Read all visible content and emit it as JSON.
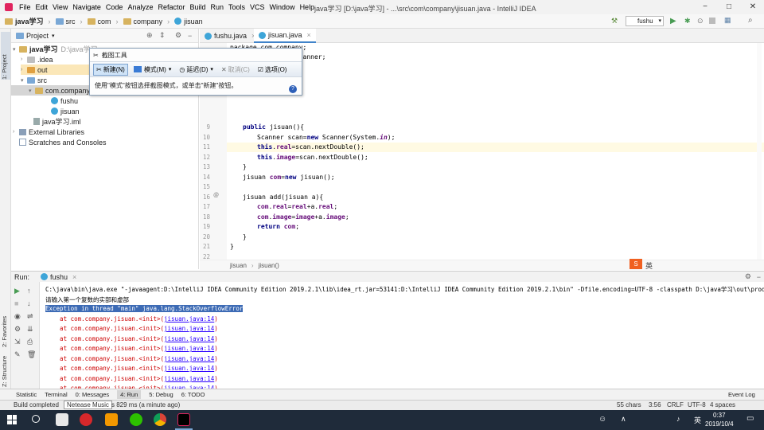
{
  "menubar": {
    "items": [
      "File",
      "Edit",
      "View",
      "Navigate",
      "Code",
      "Analyze",
      "Refactor",
      "Build",
      "Run",
      "Tools",
      "VCS",
      "Window",
      "Help"
    ],
    "title": "java学习 [D:\\java学习] - ...\\src\\com\\company\\jisuan.java - IntelliJ IDEA"
  },
  "navbar": {
    "crumbs": [
      "java学习",
      "src",
      "com",
      "company",
      "jisuan"
    ],
    "run_config": "fushu"
  },
  "leftstrip": {
    "project_tab": "1: Project",
    "favorites_tab": "2: Favorites",
    "structure_tab": "Z: Structure"
  },
  "project": {
    "header": "Project",
    "root_name": "java学习",
    "root_path": "D:\\java学习",
    "items": [
      ".idea",
      "out",
      "src",
      "com.company",
      "fushu",
      "jisuan",
      "java学习.iml",
      "External Libraries",
      "Scratches and Consoles"
    ]
  },
  "editor": {
    "tabs": [
      "fushu.java",
      "jisuan.java"
    ],
    "line_numbers": [
      "",
      "",
      "",
      "",
      "",
      "",
      "",
      "9",
      "10",
      "11",
      "12",
      "13",
      "14",
      "15",
      "16",
      "17",
      "18",
      "19",
      "20",
      "21",
      "22"
    ],
    "code_top_1": "package com.company;",
    "code_top_2": "import java.util.Scanner;",
    "breadcrumb_class": "jisuan",
    "breadcrumb_method": "jisuan()"
  },
  "snipping": {
    "title": "截图工具",
    "new_label": "新建(N)",
    "mode_label": "模式(M)",
    "delay_label": "延迟(D)",
    "cancel_label": "取消(C)",
    "options_label": "选项(O)",
    "message": "使用\"模式\"按钮选择截图模式，或单击\"新建\"按钮。"
  },
  "run": {
    "label": "Run:",
    "config": "fushu",
    "cmd": "C:\\java\\bin\\java.exe \"-javaagent:D:\\IntelliJ IDEA Community Edition 2019.2.1\\lib\\idea_rt.jar=53141:D:\\IntelliJ IDEA Community Edition 2019.2.1\\bin\" -Dfile.encoding=UTF-8 -classpath D:\\java学习\\out\\prod",
    "prompt": "请输入第一个复数的实部和虚部",
    "exception": "Exception in thread \"main\" java.lang.StackOverflowError",
    "stack_prefix": "    at com.company.jisuan.<init>(",
    "stack_link": "jisuan.java:14",
    "stack_suffix": ")"
  },
  "bottom_tabs": [
    "Statistic",
    "Terminal",
    "0: Messages",
    "4: Run",
    "5: Debug",
    "6: TODO"
  ],
  "event_log": "Event Log",
  "status": {
    "left": "Build completed",
    "tooltip": "Netease Music",
    "time_info": "s 829 ms (a minute ago)",
    "chars": "55 chars",
    "pos": "3:56",
    "crlf": "CRLF",
    "enc": "UTF-8",
    "indent": "4 spaces"
  },
  "ime_label": "英",
  "taskbar": {
    "time": "0:37",
    "date": "2019/10/4",
    "lang": "英"
  }
}
